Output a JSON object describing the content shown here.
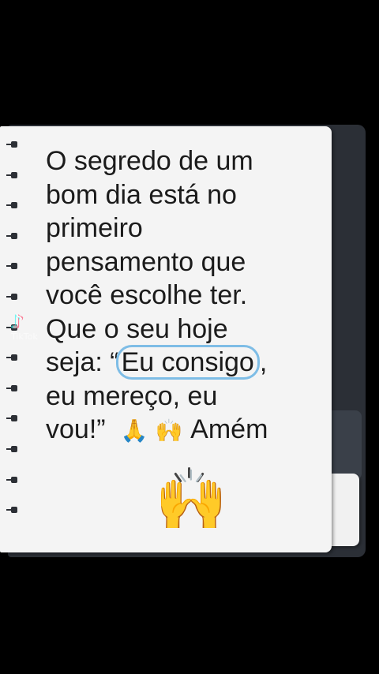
{
  "note": {
    "lines": [
      "O segredo de um",
      "bom dia está no",
      "primeiro",
      "pensamento que",
      "você escolhe ter.",
      "Que o seu hoje"
    ],
    "line7_prefix": "seja: “",
    "line7_highlight": "Eu consigo",
    "line7_suffix": ",",
    "line8": "eu mereço, eu",
    "line9_text": "vou!”",
    "line9_emoji1": "🙏",
    "line9_emoji2": "🙌",
    "line9_end": "Amém",
    "big_emoji": "🙌"
  },
  "watermark": {
    "logo": "♪",
    "name": "TikTok"
  },
  "colors": {
    "background": "#000000",
    "paper": "#f4f4f4",
    "binder": "#2b2f36",
    "highlight": "#7ebde6",
    "text": "#1b1b1b"
  }
}
